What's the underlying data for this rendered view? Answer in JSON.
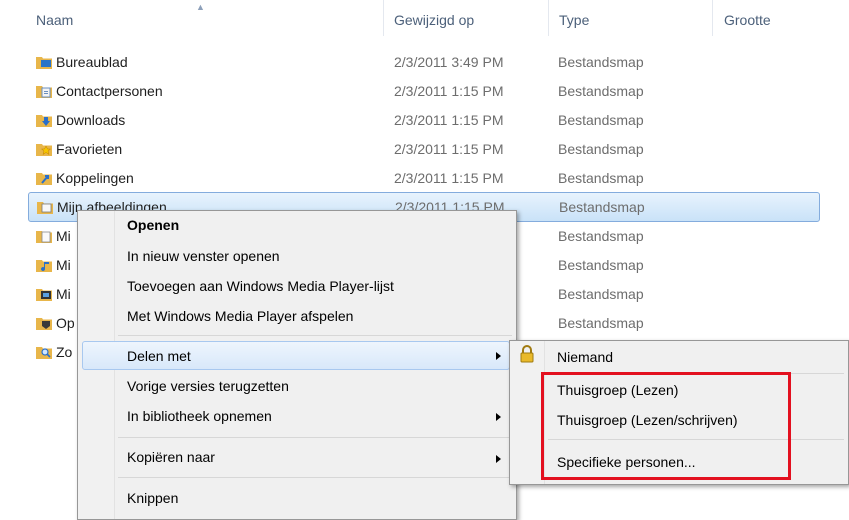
{
  "columns": {
    "name": "Naam",
    "modified": "Gewijzigd op",
    "type": "Type",
    "size": "Grootte"
  },
  "files": [
    {
      "name": "Bureaublad",
      "date": "2/3/2011 3:49 PM",
      "type": "Bestandsmap",
      "icon": "desktop-folder-icon"
    },
    {
      "name": "Contactpersonen",
      "date": "2/3/2011 1:15 PM",
      "type": "Bestandsmap",
      "icon": "contacts-folder-icon"
    },
    {
      "name": "Downloads",
      "date": "2/3/2011 1:15 PM",
      "type": "Bestandsmap",
      "icon": "downloads-folder-icon"
    },
    {
      "name": "Favorieten",
      "date": "2/3/2011 1:15 PM",
      "type": "Bestandsmap",
      "icon": "favorites-folder-icon"
    },
    {
      "name": "Koppelingen",
      "date": "2/3/2011 1:15 PM",
      "type": "Bestandsmap",
      "icon": "links-folder-icon"
    },
    {
      "name": "Mijn afbeeldingen",
      "date": "2/3/2011 1:15 PM",
      "type": "Bestandsmap",
      "icon": "pictures-folder-icon"
    },
    {
      "name": "Mi",
      "date": "",
      "type": "Bestandsmap",
      "icon": "documents-folder-icon"
    },
    {
      "name": "Mi",
      "date": "",
      "type": "Bestandsmap",
      "icon": "music-folder-icon"
    },
    {
      "name": "Mi",
      "date": "",
      "type": "Bestandsmap",
      "icon": "videos-folder-icon"
    },
    {
      "name": "Op",
      "date": "",
      "type": "Bestandsmap",
      "icon": "saved-games-folder-icon"
    },
    {
      "name": "Zo",
      "date": "",
      "type": "",
      "icon": "searches-folder-icon"
    }
  ],
  "context_menu": {
    "open": "Openen",
    "open_new_window": "In nieuw venster openen",
    "add_to_wmp_list": "Toevoegen aan Windows Media Player-lijst",
    "play_wmp": "Met Windows Media Player afspelen",
    "share_with": "Delen met",
    "restore_previous": "Vorige versies terugzetten",
    "include_in_library": "In bibliotheek opnemen",
    "copy_to": "Kopiëren naar",
    "cut": "Knippen"
  },
  "submenu": {
    "nobody": "Niemand",
    "homegroup_read": "Thuisgroep (Lezen)",
    "homegroup_readwrite": "Thuisgroep (Lezen/schrijven)",
    "specific_people": "Specifieke personen..."
  },
  "colors": {
    "highlight_box": "#e3101f",
    "selection": "#cce4f7"
  }
}
